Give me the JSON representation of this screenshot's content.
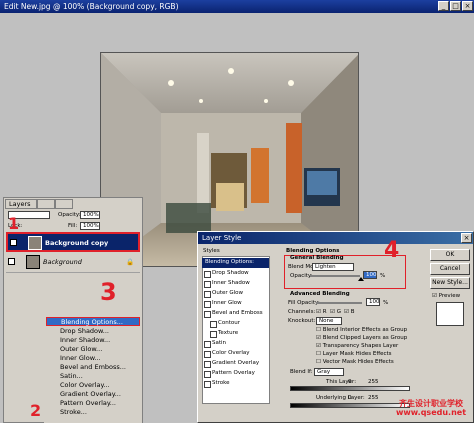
{
  "document": {
    "title": "Edit New.jpg @ 100% (Background copy, RGB)",
    "min": "_",
    "max": "□",
    "close": "×"
  },
  "layers_panel": {
    "tab_label": "Layers",
    "opacity_label": "Opacity:",
    "opacity_value": "100%",
    "lock_label": "Lock:",
    "fill_label": "Fill:",
    "fill_value": "100%",
    "layers": [
      {
        "name": "Background copy",
        "selected": true
      },
      {
        "name": "Background",
        "selected": false
      }
    ]
  },
  "context_menu": {
    "items": [
      "Blending Options...",
      "Drop Shadow...",
      "Inner Shadow...",
      "Outer Glow...",
      "Inner Glow...",
      "Bevel and Emboss...",
      "Satin...",
      "Color Overlay...",
      "Gradient Overlay...",
      "Pattern Overlay...",
      "Stroke..."
    ]
  },
  "annotations": {
    "n1": "1",
    "n2": "2",
    "n3": "3",
    "n4": "4"
  },
  "layer_style": {
    "title": "Layer Style",
    "styles_header": "Styles",
    "styles": [
      "Blending Options: Custom",
      "Drop Shadow",
      "Inner Shadow",
      "Outer Glow",
      "Inner Glow",
      "Bevel and Emboss",
      "Contour",
      "Texture",
      "Satin",
      "Color Overlay",
      "Gradient Overlay",
      "Pattern Overlay",
      "Stroke"
    ],
    "blending_options": "Blending Options",
    "general_blending": "General Blending",
    "blend_mode_label": "Blend Mode:",
    "blend_mode_value": "Lighten",
    "opacity_label": "Opacity:",
    "opacity_value": "100",
    "percent": "%",
    "advanced_blending": "Advanced Blending",
    "fill_opacity_label": "Fill Opacity:",
    "fill_opacity_value": "100",
    "channels_label": "Channels:",
    "channels": [
      "R",
      "G",
      "B"
    ],
    "knockout_label": "Knockout:",
    "knockout_value": "None",
    "options": [
      {
        "label": "Blend Interior Effects as Group",
        "checked": false
      },
      {
        "label": "Blend Clipped Layers as Group",
        "checked": true
      },
      {
        "label": "Transparency Shapes Layer",
        "checked": true
      },
      {
        "label": "Layer Mask Hides Effects",
        "checked": false
      },
      {
        "label": "Vector Mask Hides Effects",
        "checked": false
      }
    ],
    "blend_if_label": "Blend If:",
    "blend_if_value": "Gray",
    "this_layer_label": "This Layer:",
    "this_layer_min": "0",
    "this_layer_max": "255",
    "underlying_label": "Underlying Layer:",
    "underlying_min": "0",
    "underlying_max": "255",
    "buttons": {
      "ok": "OK",
      "cancel": "Cancel",
      "new_style": "New Style...",
      "preview": "Preview"
    }
  },
  "watermark": {
    "line1": "齐生设计职业学校",
    "line2": "www.qsedu.net"
  },
  "colors": {
    "accent": "#0a246a",
    "annotation": "#e0212a",
    "highlight": "#316ac5"
  }
}
